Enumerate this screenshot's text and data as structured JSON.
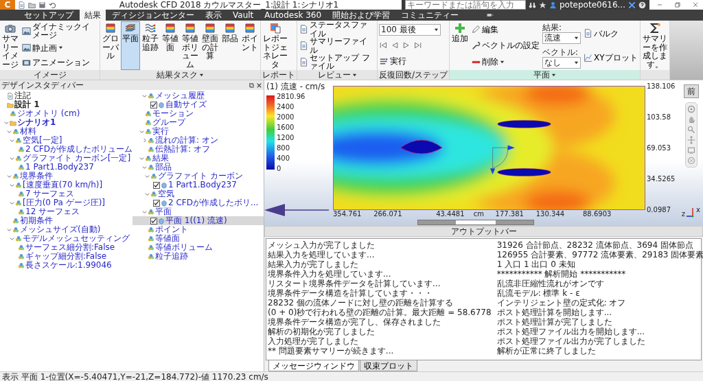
{
  "title_bar": {
    "logo": "C",
    "title": "Autodesk CFD 2018  カウルマスター_1:設計 1:シナリオ1",
    "search": {
      "placeholder": "キーワードまたは語句を入力"
    },
    "user": "potepote0616..."
  },
  "ribbon_tabs": [
    {
      "label": "セットアップ",
      "selected": false
    },
    {
      "label": "結果",
      "selected": true
    },
    {
      "label": "ディシジョンセンター",
      "selected": false
    },
    {
      "label": "表示",
      "selected": false
    },
    {
      "label": "Vault",
      "selected": false
    },
    {
      "label": "Autodesk 360",
      "selected": false
    },
    {
      "label": "開始および学習",
      "selected": false
    },
    {
      "label": "コミュニティー",
      "selected": false
    }
  ],
  "ribbon_groups": [
    {
      "label": "イメージ",
      "items": [
        {
          "kind": "large",
          "label": "サマリーイメージ"
        },
        {
          "kind": "stack",
          "items": [
            {
              "kind": "button",
              "label": "ダイナミックイメージ"
            },
            {
              "kind": "button",
              "label": "静止画",
              "dropdown": true
            },
            {
              "kind": "button",
              "label": "アニメーション"
            }
          ]
        }
      ]
    },
    {
      "label": "結果タスク",
      "dropdown": true,
      "items": [
        {
          "kind": "large",
          "label": "グローバル",
          "selected": false
        },
        {
          "kind": "large",
          "label": "平面",
          "selected": true
        },
        {
          "kind": "large",
          "label": "粒子追跡",
          "selected": false
        },
        {
          "kind": "large",
          "label": "等値面",
          "selected": false
        },
        {
          "kind": "large",
          "label": "等値ボリューム",
          "selected": false
        },
        {
          "kind": "large",
          "label": "壁面の計算",
          "selected": false
        },
        {
          "kind": "large",
          "label": "部品",
          "selected": false
        },
        {
          "kind": "large",
          "label": "ポイント",
          "selected": false
        }
      ]
    },
    {
      "label": "レポート",
      "items": [
        {
          "kind": "large",
          "label": "レポートジェネレータ"
        }
      ]
    },
    {
      "label": "レビュー",
      "dropdown": true,
      "items": [
        {
          "kind": "stack",
          "items": [
            {
              "kind": "button",
              "label": "ステータスファイル"
            },
            {
              "kind": "button",
              "label": "サマリーファイル"
            },
            {
              "kind": "button",
              "label": "セットアップ ファイル"
            }
          ]
        }
      ]
    },
    {
      "label": "反復回数/ステップ",
      "items": [
        {
          "kind": "stack",
          "items": [
            {
              "kind": "combo",
              "value": "100 最後"
            },
            {
              "kind": "steps"
            },
            {
              "kind": "button",
              "label": "実行"
            }
          ]
        }
      ]
    },
    {
      "label": "平面",
      "dropdown": true,
      "contextual": true,
      "items": [
        {
          "kind": "large",
          "label": "追加"
        },
        {
          "kind": "stack",
          "items": [
            {
              "kind": "button",
              "label": "編集"
            },
            {
              "kind": "button",
              "label": "ベクトルの設定"
            },
            {
              "kind": "button",
              "label": "削除",
              "dropdown": true
            }
          ]
        },
        {
          "kind": "stack",
          "items": [
            {
              "kind": "field",
              "label": "結果:",
              "value": "流速"
            },
            {
              "kind": "field",
              "label": "ベクトル:",
              "value": "なし"
            }
          ]
        },
        {
          "kind": "stack",
          "items": [
            {
              "kind": "button",
              "label": "バルク"
            },
            {
              "kind": "button",
              "label": "XYプロット"
            }
          ]
        }
      ]
    },
    {
      "items": [
        {
          "kind": "large",
          "label": "サマリーを作成します。"
        }
      ]
    }
  ],
  "design_study_bar": {
    "title": "デザインスタディバー",
    "tree": [
      {
        "label": "注記",
        "selected": false
      },
      {
        "label": "設計 1",
        "selected": false,
        "children": [
          {
            "label": "ジオメトリ (cm)",
            "selected": false
          },
          {
            "label": "シナリオ1",
            "expanded": true,
            "selected": false,
            "children": [
              {
                "label": "材料",
                "expanded": true,
                "selected": false,
                "children": [
                  {
                    "label": "空気[一定]",
                    "expanded": true,
                    "selected": false,
                    "children": [
                      {
                        "label": "2 CFDが作成したボリューム",
                        "selected": false
                      }
                    ]
                  },
                  {
                    "label": "グラファイト カーボン[一定]",
                    "expanded": true,
                    "selected": false,
                    "children": [
                      {
                        "label": "1 Part1.Body237",
                        "selected": false
                      }
                    ]
                  }
                ]
              },
              {
                "label": "境界条件",
                "expanded": true,
                "selected": false,
                "children": [
                  {
                    "label": "[速度垂直(70 km/h)]",
                    "expanded": true,
                    "selected": false,
                    "children": [
                      {
                        "label": "7 サーフェス",
                        "selected": false
                      }
                    ]
                  },
                  {
                    "label": "[圧力(0 Pa ゲージ圧)]",
                    "expanded": true,
                    "selected": false,
                    "children": [
                      {
                        "label": "12 サーフェス",
                        "selected": false
                      }
                    ]
                  }
                ]
              },
              {
                "label": "初期条件",
                "selected": false
              },
              {
                "label": "メッシュサイズ(自動)",
                "expanded": true,
                "selected": false,
                "children": [
                  {
                    "label": "モデルメッシュセッティング",
                    "expanded": true,
                    "selected": false,
                    "children": [
                      {
                        "label": "サーフェス細分割:False",
                        "selected": false
                      },
                      {
                        "label": "ギャップ細分割:False",
                        "selected": false
                      },
                      {
                        "label": "長さスケール:1.99046",
                        "selected": false
                      }
                    ]
                  },
                  {
                    "label": "メッシュ履歴",
                    "expanded": true,
                    "selected": false,
                    "children": [
                      {
                        "label": "自動サイズ",
                        "checked": true,
                        "selected": false
                      }
                    ]
                  }
                ]
              },
              {
                "label": "モーション",
                "selected": false
              },
              {
                "label": "グループ",
                "selected": false
              },
              {
                "label": "実行",
                "expanded": true,
                "selected": false,
                "children": [
                  {
                    "label": "流れの計算: オン",
                    "expanded": false,
                    "selected": false
                  },
                  {
                    "label": "伝熱計算: オフ",
                    "selected": false
                  }
                ]
              },
              {
                "label": "結果",
                "expanded": true,
                "selected": false,
                "children": [
                  {
                    "label": "部品",
                    "expanded": true,
                    "selected": false,
                    "children": [
                      {
                        "label": "グラファイト カーボン",
                        "expanded": true,
                        "selected": false,
                        "children": [
                          {
                            "label": "1 Part1.Body237",
                            "checked": true,
                            "selected": false
                          }
                        ]
                      },
                      {
                        "label": "空気",
                        "expanded": true,
                        "selected": false,
                        "children": [
                          {
                            "label": "2 CFDが作成したボリ...",
                            "checked": true,
                            "selected": false
                          }
                        ]
                      }
                    ]
                  },
                  {
                    "label": "平面",
                    "expanded": true,
                    "selected": false,
                    "children": [
                      {
                        "label": "平面 1((1) 流速)",
                        "checked": true,
                        "selected": true
                      }
                    ]
                  },
                  {
                    "label": "ポイント",
                    "selected": false
                  },
                  {
                    "label": "等値面",
                    "selected": false
                  },
                  {
                    "label": "等値ボリューム",
                    "selected": false
                  },
                  {
                    "label": "粒子追跡",
                    "selected": false
                  }
                ]
              }
            ]
          }
        ]
      }
    ]
  },
  "viewport": {
    "title": "(1) 流速 - cm/s",
    "legend": [
      "2810.96",
      "2400",
      "2000",
      "1600",
      "1200",
      "800",
      "400",
      "0"
    ],
    "right_axis": [
      "138.106",
      "103.58",
      "69.053",
      "34.5265",
      "0.0987"
    ],
    "bottom_axis": [
      "354.761",
      "266.071",
      "43.4481",
      "cm",
      "177.381",
      "130.344",
      "88.6903"
    ],
    "view_cube": "前",
    "triad": [
      "x",
      "z"
    ]
  },
  "output_bar": {
    "title": "アウトプットバー",
    "log": [
      "メッシュ入力が完了しました",
      "結果入力を処理しています...",
      "結果入力が完了しました",
      "境界条件入力を処理しています...",
      "リスタート境界条件データを計算しています...",
      "境界条件データ構造を計算しています・・・",
      "28232 個の流体ノードに対し壁の距離を計算する",
      "(0 + 0)秒で行われる壁の距離の計算。最大距離 = 58.6778",
      "境界条件データ構造が完了し、保存されました",
      "解析の初期化が完了しました",
      "入力処理が完了しました",
      "** 問題要素サマリーが続きます...",
      "31926 合計節点、28232 流体節点、3694 固体節点",
      "126955 合計要素、97772 流体要素、29183 固体要素",
      "1 入口 1 出口 0 未知",
      "*********** 解析開始 ***********",
      "乱流非圧縮性流れがオンです",
      "乱流モデル: 標準 k - ε",
      "インテリジェント壁の定式化: オフ",
      "ポスト処理計算を開始します...",
      "ポスト処理計算が完了しました",
      "ポスト処理ファイル出力を開始します...",
      "ポスト処理ファイル出力が完了しました",
      "解析が正常に終了しました"
    ],
    "tabs": [
      {
        "label": "メッセージウィンドウ",
        "selected": true
      },
      {
        "label": "収束プロット",
        "selected": false
      }
    ]
  },
  "status_bar": "表示 平面 1-位置(X=-5.40471,Y=-21,Z=184.772)-値 1170.23 cm/s"
}
